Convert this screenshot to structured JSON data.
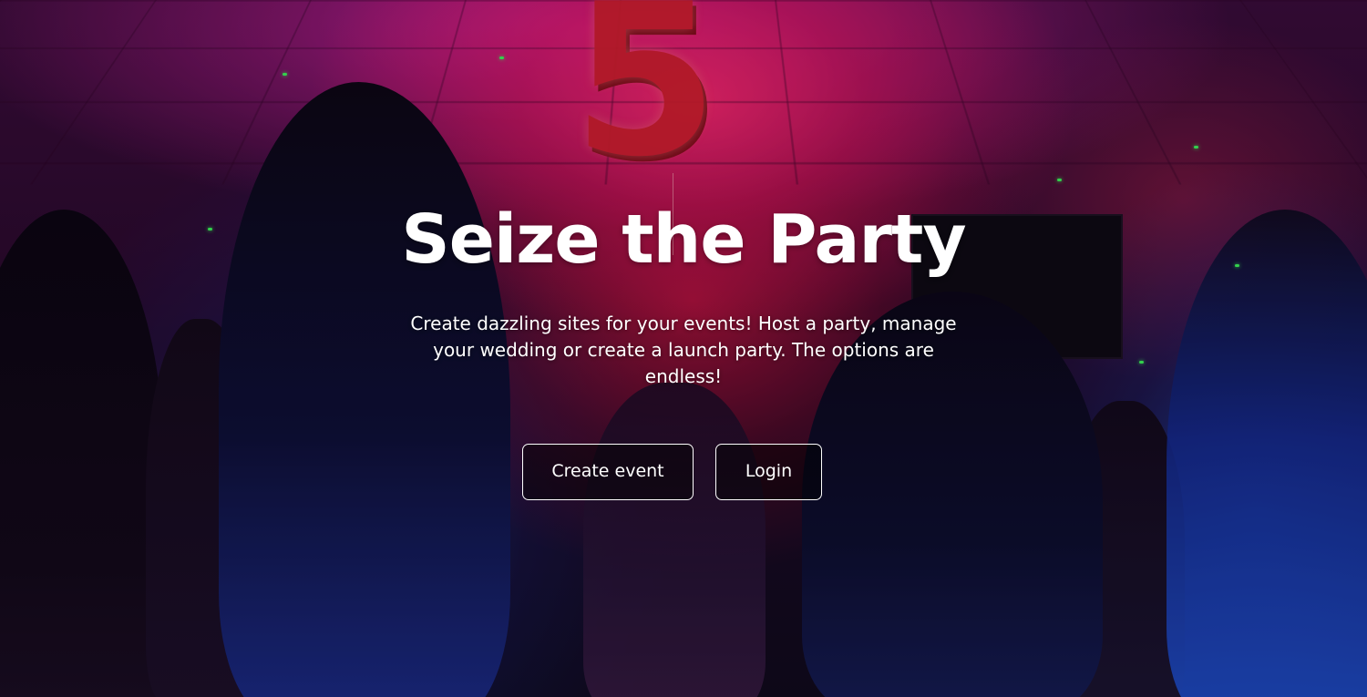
{
  "hero": {
    "title": "Seize the Party",
    "subtitle": "Create dazzling sites for your events! Host a party, manage your wedding or create a launch party. The options are endless!",
    "balloon_digit": "5",
    "actions": {
      "create_event_label": "Create event",
      "login_label": "Login"
    }
  },
  "colors": {
    "text": "#ffffff",
    "button_border": "#ffffff",
    "accent_pink": "#e0186a",
    "accent_blue": "#1f54d6"
  }
}
